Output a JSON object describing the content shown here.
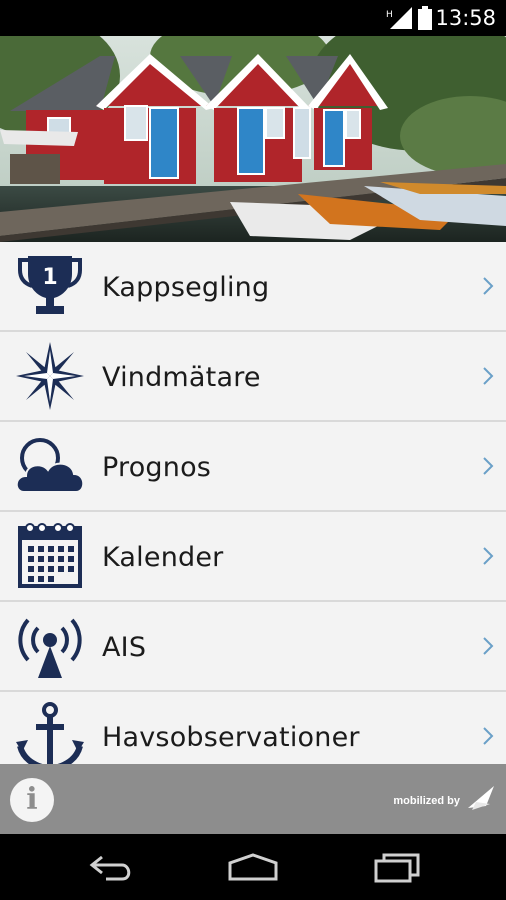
{
  "status_bar": {
    "time": "13:58",
    "network_type": "H",
    "icons": [
      "signal-icon",
      "battery-icon"
    ]
  },
  "menu": {
    "items": [
      {
        "label": "Kappsegling",
        "icon": "trophy-icon",
        "badge": "1"
      },
      {
        "label": "Vindmätare",
        "icon": "compass-rose-icon"
      },
      {
        "label": "Prognos",
        "icon": "weather-cloud-icon"
      },
      {
        "label": "Kalender",
        "icon": "calendar-icon"
      },
      {
        "label": "AIS",
        "icon": "broadcast-antenna-icon"
      },
      {
        "label": "Havsobservationer",
        "icon": "anchor-icon"
      }
    ],
    "chevron_icon": "chevron-right-icon"
  },
  "info_bar": {
    "info_button": "i",
    "branding": "mobilized by"
  },
  "nav_bar": {
    "buttons": [
      "back-icon",
      "home-icon",
      "recent-apps-icon"
    ]
  },
  "colors": {
    "icon_navy": "#1c2d55",
    "chevron_blue": "#6aa0c8",
    "info_bar": "#8d8d8d"
  }
}
